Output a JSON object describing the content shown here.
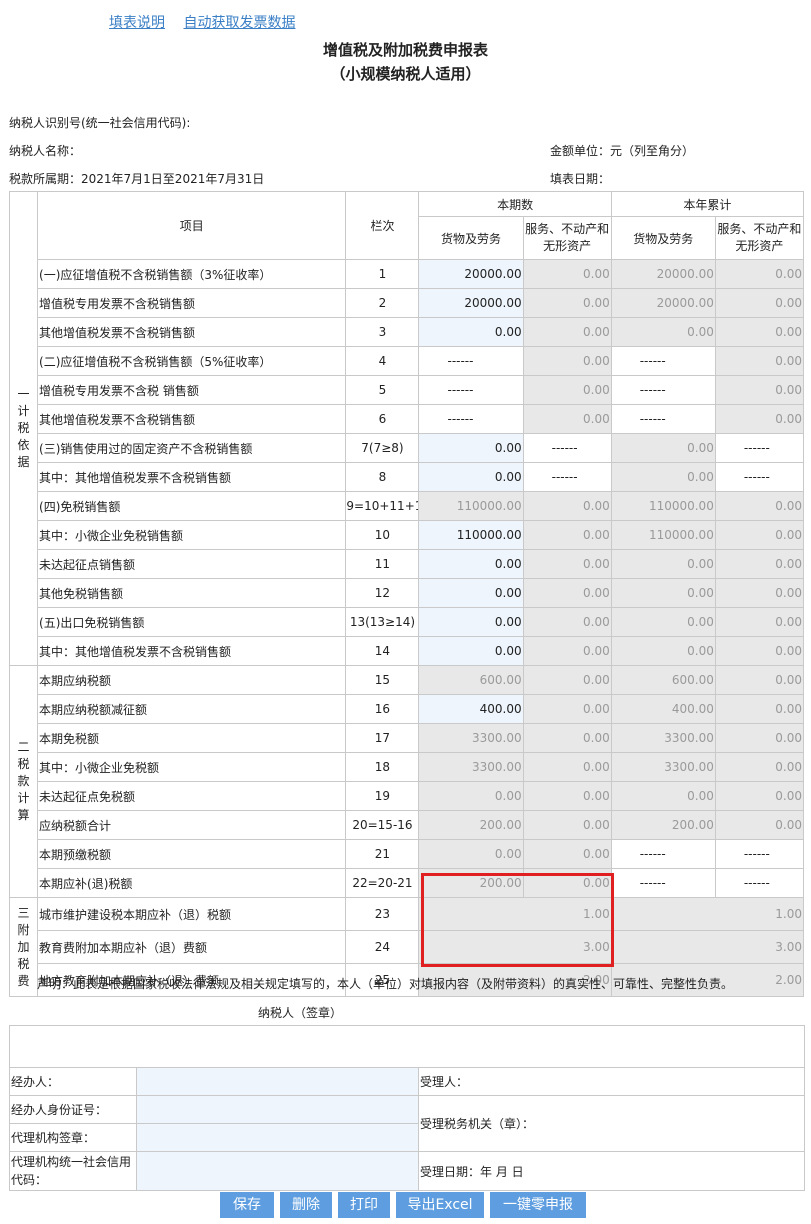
{
  "links": {
    "instructions": "填表说明",
    "auto_invoice": "自动获取发票数据"
  },
  "title": {
    "line1": "增值税及附加税费申报表",
    "line2": "（小规模纳税人适用）"
  },
  "meta": {
    "taxpayer_id_label": "纳税人识别号(统一社会信用代码):",
    "taxpayer_name_label": "纳税人名称：",
    "amount_unit": "金额单位：元（列至角分）",
    "period": "税款所属期：2021年7月1日至2021年7月31日",
    "fill_date_label": "填表日期："
  },
  "headers": {
    "item": "项目",
    "lanci": "栏次",
    "current": "本期数",
    "ytd": "本年累计",
    "goods": "货物及劳务",
    "services": "服务、不动产和无形资产"
  },
  "sections": {
    "s1": "一计税依据",
    "s2": "二税款计算",
    "s3": "三附加税费"
  },
  "rows": [
    {
      "item": "(一)应征增值税不含税销售额（3%征收率）",
      "lan": "1",
      "c1": "20000.00",
      "c2": "0.00",
      "c3": "20000.00",
      "c4": "0.00"
    },
    {
      "item": "增值税专用发票不含税销售额",
      "lan": "2",
      "c1": "20000.00",
      "c2": "0.00",
      "c3": "20000.00",
      "c4": "0.00"
    },
    {
      "item": "其他增值税发票不含税销售额",
      "lan": "3",
      "c1": "0.00",
      "c2": "0.00",
      "c3": "0.00",
      "c4": "0.00"
    },
    {
      "item": "(二)应征增值税不含税销售额（5%征收率）",
      "lan": "4",
      "c1": "------",
      "c2": "0.00",
      "c3": "------",
      "c4": "0.00"
    },
    {
      "item": "增值税专用发票不含税 销售额",
      "lan": "5",
      "c1": "------",
      "c2": "0.00",
      "c3": "------",
      "c4": "0.00"
    },
    {
      "item": "其他增值税发票不含税销售额",
      "lan": "6",
      "c1": "------",
      "c2": "0.00",
      "c3": "------",
      "c4": "0.00"
    },
    {
      "item": "(三)销售使用过的固定资产不含税销售额",
      "lan": "7(7≥8)",
      "c1": "0.00",
      "c2": "------",
      "c3": "0.00",
      "c4": "------"
    },
    {
      "item": "其中：其他增值税发票不含税销售额",
      "lan": "8",
      "c1": "0.00",
      "c2": "------",
      "c3": "0.00",
      "c4": "------"
    },
    {
      "item": "(四)免税销售额",
      "lan": "9=10+11+12",
      "c1": "110000.00",
      "c2": "0.00",
      "c3": "110000.00",
      "c4": "0.00"
    },
    {
      "item": "其中：小微企业免税销售额",
      "lan": "10",
      "c1": "110000.00",
      "c2": "0.00",
      "c3": "110000.00",
      "c4": "0.00"
    },
    {
      "item": "未达起征点销售额",
      "lan": "11",
      "c1": "0.00",
      "c2": "0.00",
      "c3": "0.00",
      "c4": "0.00"
    },
    {
      "item": "其他免税销售额",
      "lan": "12",
      "c1": "0.00",
      "c2": "0.00",
      "c3": "0.00",
      "c4": "0.00"
    },
    {
      "item": "(五)出口免税销售额",
      "lan": "13(13≥14)",
      "c1": "0.00",
      "c2": "0.00",
      "c3": "0.00",
      "c4": "0.00"
    },
    {
      "item": "其中：其他增值税发票不含税销售额",
      "lan": "14",
      "c1": "0.00",
      "c2": "0.00",
      "c3": "0.00",
      "c4": "0.00"
    },
    {
      "item": "本期应纳税额",
      "lan": "15",
      "c1": "600.00",
      "c2": "0.00",
      "c3": "600.00",
      "c4": "0.00"
    },
    {
      "item": "本期应纳税额减征额",
      "lan": "16",
      "c1": "400.00",
      "c2": "0.00",
      "c3": "400.00",
      "c4": "0.00"
    },
    {
      "item": "本期免税额",
      "lan": "17",
      "c1": "3300.00",
      "c2": "0.00",
      "c3": "3300.00",
      "c4": "0.00"
    },
    {
      "item": "其中：小微企业免税额",
      "lan": "18",
      "c1": "3300.00",
      "c2": "0.00",
      "c3": "3300.00",
      "c4": "0.00"
    },
    {
      "item": "未达起征点免税额",
      "lan": "19",
      "c1": "0.00",
      "c2": "0.00",
      "c3": "0.00",
      "c4": "0.00"
    },
    {
      "item": "应纳税额合计",
      "lan": "20=15-16",
      "c1": "200.00",
      "c2": "0.00",
      "c3": "200.00",
      "c4": "0.00"
    },
    {
      "item": "本期预缴税额",
      "lan": "21",
      "c1": "0.00",
      "c2": "0.00",
      "c3": "------",
      "c4": "------"
    },
    {
      "item": "本期应补(退)税额",
      "lan": "22=20-21",
      "c1": "200.00",
      "c2": "0.00",
      "c3": "------",
      "c4": "------"
    },
    {
      "item": "城市维护建设税本期应补（退）税额",
      "lan": "23",
      "cur": "1.00",
      "ytd": "1.00"
    },
    {
      "item": "教育费附加本期应补（退）费额",
      "lan": "24",
      "cur": "3.00",
      "ytd": "3.00"
    },
    {
      "item": "地方教育附加本期应补（退）费额",
      "lan": "25",
      "cur": "2.00",
      "ytd": "2.00"
    }
  ],
  "declaration": "声明：此表是根据国家税收法律法规及相关规定填写的，本人（单位）对填报内容（及附带资料）的真实性、可靠性、完整性负责。",
  "signature": "纳税人（签章）",
  "sign_fields": {
    "handler": "经办人：",
    "handler_id": "经办人身份证号：",
    "agency_seal": "代理机构签章：",
    "agency_code": "代理机构统一社会信用代码：",
    "receiver": "受理人：",
    "tax_office": "受理税务机关（章）：",
    "accept_date": "受理日期：年 月 日"
  },
  "buttons": {
    "save": "保存",
    "delete": "删除",
    "print": "打印",
    "export": "导出Excel",
    "zero_declare": "一键零申报"
  }
}
